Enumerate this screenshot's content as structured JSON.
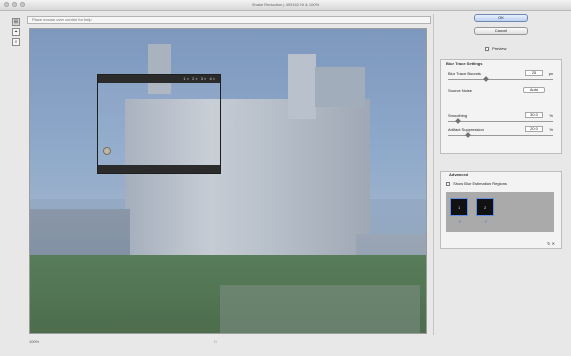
{
  "window": {
    "title": "Shake Reduction | 493162 HI & 100%"
  },
  "toolbar": {
    "tools": [
      {
        "name": "grid-tool",
        "icon": "grid-icon",
        "glyph": "⊞"
      },
      {
        "name": "selection-tool",
        "icon": "selection-icon",
        "glyph": "⌖"
      },
      {
        "name": "zoom-tool",
        "icon": "zoom-icon",
        "glyph": "⌕"
      }
    ]
  },
  "hint": {
    "text": "Place mouse over control for help"
  },
  "canvas": {
    "loupe_controls": "1× 2× 3× 4×"
  },
  "bottom": {
    "left": "100%",
    "center": "□"
  },
  "panel": {
    "ok_label": "OK",
    "cancel_label": "Cancel",
    "preview_label": "Preview",
    "blur_settings": {
      "title": "Blur Trace Settings",
      "blur_trace_bounds": {
        "label": "Blur Trace Bounds",
        "value": "25",
        "unit": "px"
      },
      "source_noise": {
        "label": "Source Noise",
        "value": "Auto"
      },
      "smoothing": {
        "label": "Smoothing",
        "value": "30.0"
      },
      "artifact_suppression": {
        "label": "Artifact Suppression",
        "value": "20.0"
      }
    },
    "advanced": {
      "title": "Advanced",
      "show_blur_label": "Show Blur Estimation Regions",
      "thumb1": "1",
      "thumb2": "2"
    },
    "tiny_icons": "↻ ✕"
  }
}
